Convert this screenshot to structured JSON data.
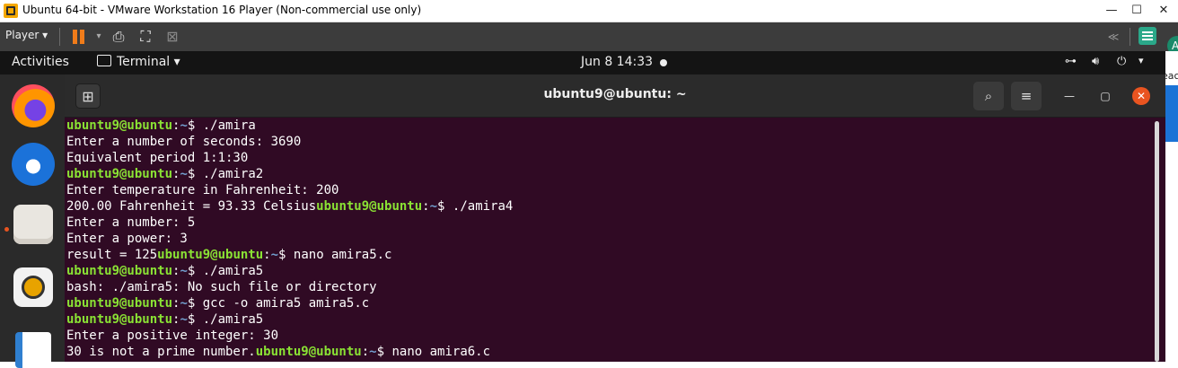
{
  "vmware": {
    "window_title": "Ubuntu 64-bit - VMware Workstation 16 Player (Non-commercial use only)",
    "controls": {
      "minimize": "—",
      "maximize": "☐",
      "close": "✕"
    },
    "toolbar": {
      "player_menu": "Player ▾",
      "back_glyph": "≪"
    }
  },
  "gnome": {
    "activities": "Activities",
    "app_menu": "Terminal ▾",
    "clock": "Jun 8  14:33"
  },
  "terminal": {
    "title": "ubuntu9@ubuntu: ~",
    "newtab_glyph": "⊞",
    "search_glyph": "⌕",
    "menu_glyph": "≡",
    "lines": [
      {
        "prompt": true,
        "user": "ubuntu9@ubuntu",
        "path": "~",
        "cmd": "./amira"
      },
      {
        "text": "Enter a number of seconds: 3690"
      },
      {
        "text": "Equivalent period 1:1:30"
      },
      {
        "prompt": true,
        "user": "ubuntu9@ubuntu",
        "path": "~",
        "cmd": "./amira2"
      },
      {
        "text": "Enter temperature in Fahrenheit: 200"
      },
      {
        "prompt": true,
        "pre": "200.00 Fahrenheit = 93.33 Celsius",
        "user": "ubuntu9@ubuntu",
        "path": "~",
        "cmd": "./amira4"
      },
      {
        "text": "Enter a number: 5"
      },
      {
        "text": "Enter a power: 3"
      },
      {
        "prompt": true,
        "pre": "result = 125",
        "user": "ubuntu9@ubuntu",
        "path": "~",
        "cmd": "nano amira5.c"
      },
      {
        "prompt": true,
        "user": "ubuntu9@ubuntu",
        "path": "~",
        "cmd": "./amira5"
      },
      {
        "text": "bash: ./amira5: No such file or directory"
      },
      {
        "prompt": true,
        "user": "ubuntu9@ubuntu",
        "path": "~",
        "cmd": "gcc -o amira5 amira5.c"
      },
      {
        "prompt": true,
        "user": "ubuntu9@ubuntu",
        "path": "~",
        "cmd": "./amira5"
      },
      {
        "text": "Enter a positive integer: 30"
      },
      {
        "prompt": true,
        "pre": "30 is not a prime number.",
        "user": "ubuntu9@ubuntu",
        "path": "~",
        "cmd": "nano amira6.c"
      }
    ]
  },
  "host": {
    "avatar_letter": "A",
    "side_text": "eac"
  },
  "colors": {
    "terminal_bg": "#300a24",
    "prompt_user": "#8ae234",
    "prompt_path": "#729fcf",
    "ubuntu_orange": "#e95420",
    "vmware_orange": "#f07c1a"
  }
}
